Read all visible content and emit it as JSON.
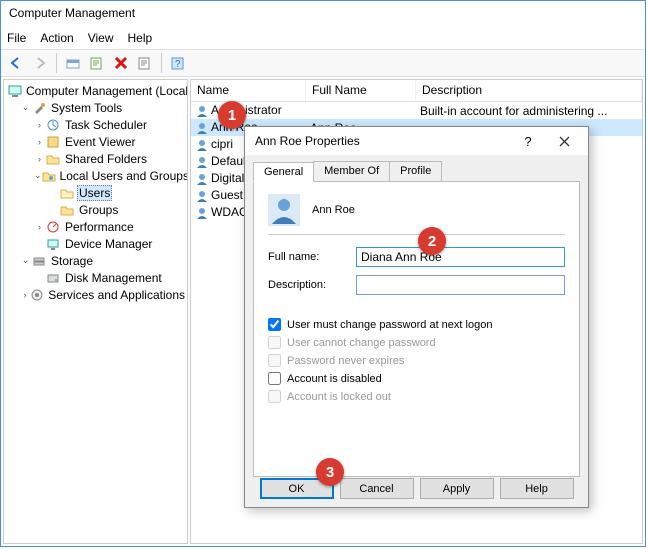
{
  "window": {
    "title": "Computer Management"
  },
  "menu": {
    "file": "File",
    "action": "Action",
    "view": "View",
    "help": "Help"
  },
  "tree": {
    "root": "Computer Management (Local)",
    "systools": "System Tools",
    "task": "Task Scheduler",
    "event": "Event Viewer",
    "shared": "Shared Folders",
    "lug": "Local Users and Groups",
    "users": "Users",
    "groups": "Groups",
    "perf": "Performance",
    "devmgr": "Device Manager",
    "storage": "Storage",
    "diskmgmt": "Disk Management",
    "services": "Services and Applications"
  },
  "list": {
    "headers": {
      "name": "Name",
      "full": "Full Name",
      "desc": "Description"
    },
    "rows": [
      {
        "name": "Administrator",
        "full": "",
        "desc": "Built-in account for administering ..."
      },
      {
        "name": "Ann Roe",
        "full": "Ann Roe",
        "desc": ""
      },
      {
        "name": "cipri",
        "full": "",
        "desc": ""
      },
      {
        "name": "DefaultAcco...",
        "full": "",
        "desc": ""
      },
      {
        "name": "Digital Citizen",
        "full": "",
        "desc": ""
      },
      {
        "name": "Guest",
        "full": "",
        "desc": ""
      },
      {
        "name": "WDAGUtility...",
        "full": "",
        "desc": ""
      }
    ]
  },
  "dialog": {
    "title": "Ann Roe Properties",
    "tabs": {
      "general": "General",
      "member": "Member Of",
      "profile": "Profile"
    },
    "username": "Ann Roe",
    "fullname_label": "Full name:",
    "fullname_value": "Diana Ann Roe",
    "desc_label": "Description:",
    "desc_value": "",
    "checks": {
      "mustchange": "User must change password at next logon",
      "cannotchange": "User cannot change password",
      "never": "Password never expires",
      "disabled": "Account is disabled",
      "locked": "Account is locked out"
    },
    "buttons": {
      "ok": "OK",
      "cancel": "Cancel",
      "apply": "Apply",
      "help": "Help"
    }
  },
  "annotations": {
    "a1": "1",
    "a2": "2",
    "a3": "3"
  }
}
